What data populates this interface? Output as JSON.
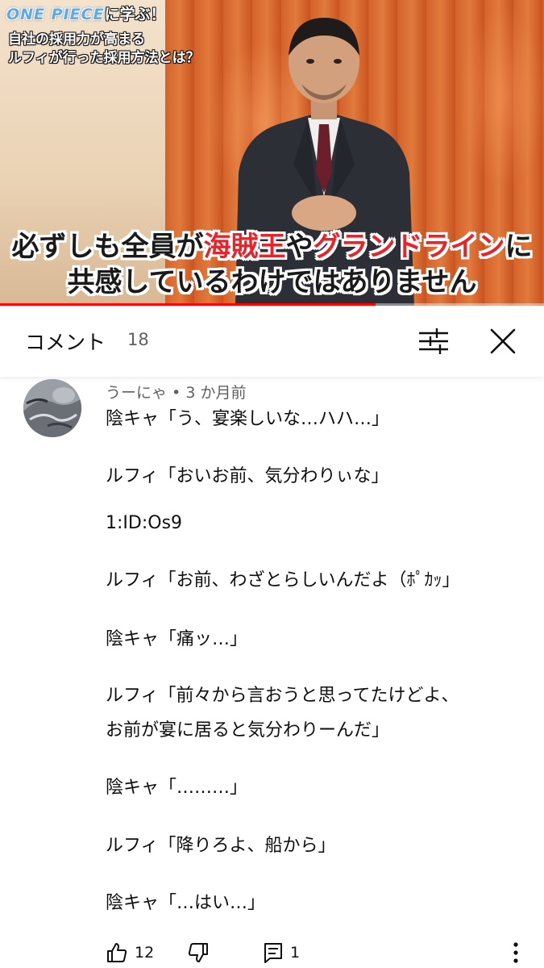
{
  "video": {
    "logo_text": "ONE PIECE",
    "title_suffix": "に学ぶ！",
    "title_line2": "自社の採用力が高まる",
    "title_line3": "ルフィが行った採用方法とは？",
    "caption": {
      "line1_a": "必ずしも全員が",
      "line1_b": "海賊王",
      "line1_c": "や",
      "line1_d": "グランドライン",
      "line1_e": "に",
      "line2": "共感しているわけではありません"
    },
    "progress": 0.69,
    "colors": {
      "progress": "#ff0000",
      "caption_highlight": "#e8242a"
    }
  },
  "comments_panel": {
    "title": "コメント",
    "count": "18",
    "filter_icon": "sliders-icon",
    "close_icon": "close-icon"
  },
  "comment": {
    "author": "うーにゃ",
    "separator": " • ",
    "time": "3 か月前",
    "lines": [
      "陰キャ「う、宴楽しいな…ハハ…」",
      "ルフィ「おいお前、気分わりぃな」",
      "1:ID:Os9",
      "ルフィ「お前、わざとらしいんだよ（ﾎﾟｶｯ」",
      "陰キャ「痛ッ…」",
      "ルフィ「前々から言おうと思ってたけどよ、",
      "お前が宴に居ると気分わりーんだ」",
      "陰キャ「………」",
      "ルフィ「降りろよ、船から」",
      "陰キャ「…はい…」"
    ],
    "likes": "12",
    "replies": "1",
    "icons": [
      "thumbs-up-icon",
      "thumbs-down-icon",
      "reply-icon",
      "more-vert-icon"
    ]
  }
}
